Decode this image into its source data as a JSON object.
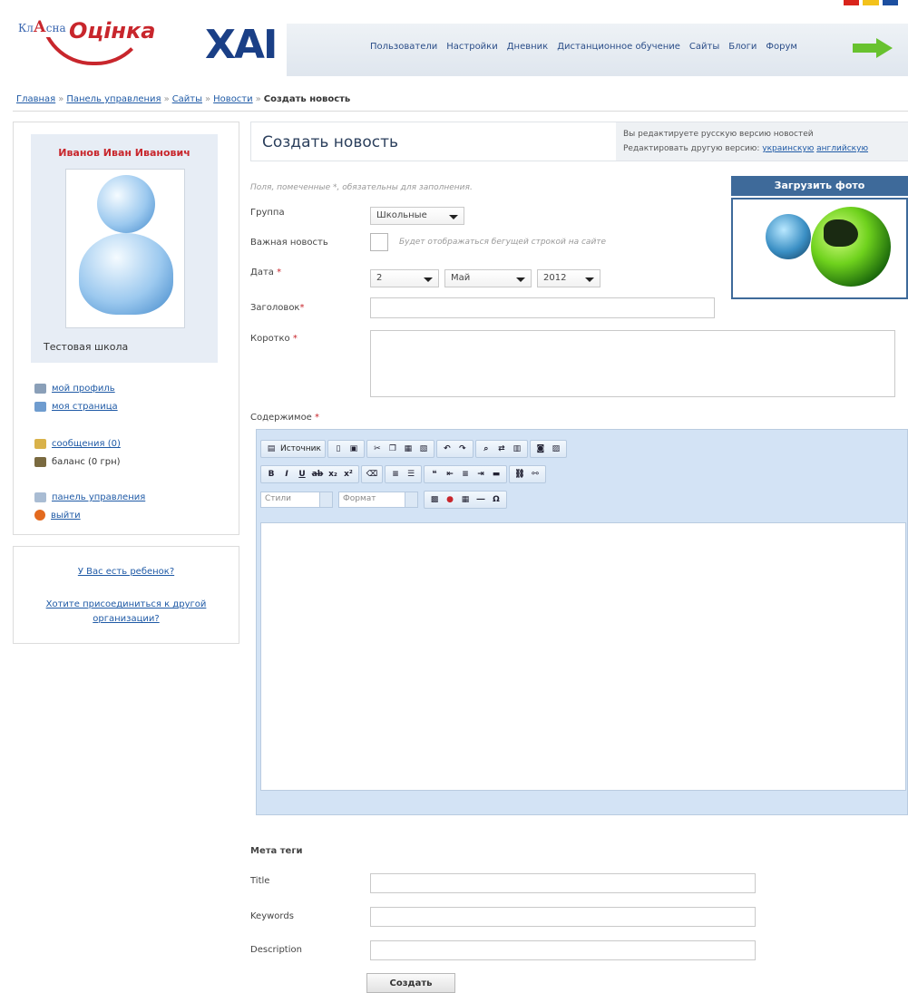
{
  "header": {
    "logo_prefix": "Кл",
    "logo_accent": "А",
    "logo_suffix": "сна",
    "logo_main": "Оцінка",
    "xai_logo": "ХАІ",
    "nav": [
      "Пользователи",
      "Настройки",
      "Дневник",
      "Дистанционное обучение",
      "Сайты",
      "Блоги",
      "Форум"
    ],
    "arrow_icon": "arrow-right-icon",
    "flag_colors": [
      "#d9241c",
      "#f3c21b",
      "#1c4fa0"
    ]
  },
  "breadcrumb": {
    "items": [
      "Главная",
      "Панель управления",
      "Сайты",
      "Новости"
    ],
    "separator": "»",
    "current": "Создать новость"
  },
  "sidebar": {
    "user_name": "Иванов Иван Иванович",
    "school": "Тестовая школа",
    "links": [
      {
        "label": "мой профиль",
        "icon": "profile-icon"
      },
      {
        "label": "моя страница",
        "icon": "page-icon"
      },
      {
        "label": "сообщения (0)",
        "icon": "messages-icon"
      },
      {
        "label": "баланс (0 грн)",
        "icon": "balance-icon"
      },
      {
        "label": "панель управления",
        "icon": "control-panel-icon"
      },
      {
        "label": "выйти",
        "icon": "logout-icon"
      }
    ],
    "child_question": "У Вас есть ребенок?",
    "join_question": "Хотите присоединиться к другой организации?"
  },
  "main": {
    "title": "Создать новость",
    "lang_note_line1": "Вы редактируете русскую версию новостей",
    "lang_note_line2_prefix": "Редактировать другую версию:",
    "lang_ukrainian": "украинскую",
    "lang_english": "английскую",
    "required_note": "Поля, помеченные *, обязательны для заполнения.",
    "group_label": "Группа",
    "group_value": "Школьные",
    "important_label": "Важная новость",
    "important_hint": "Будет отображаться бегущей строкой на сайте",
    "date_label": "Дата",
    "date_day": "2",
    "date_month": "Май",
    "date_year": "2012",
    "headline_label": "Заголовок",
    "short_label": "Коротко",
    "content_label": "Содержимое",
    "required_mark": "*",
    "upload_photo": "Загрузить фото"
  },
  "editor": {
    "source_label": "Источник",
    "styles_placeholder": "Стили",
    "format_placeholder": "Формат"
  },
  "meta": {
    "heading": "Мета теги",
    "title_label": "Title",
    "keywords_label": "Keywords",
    "description_label": "Description"
  },
  "submit_label": "Создать"
}
